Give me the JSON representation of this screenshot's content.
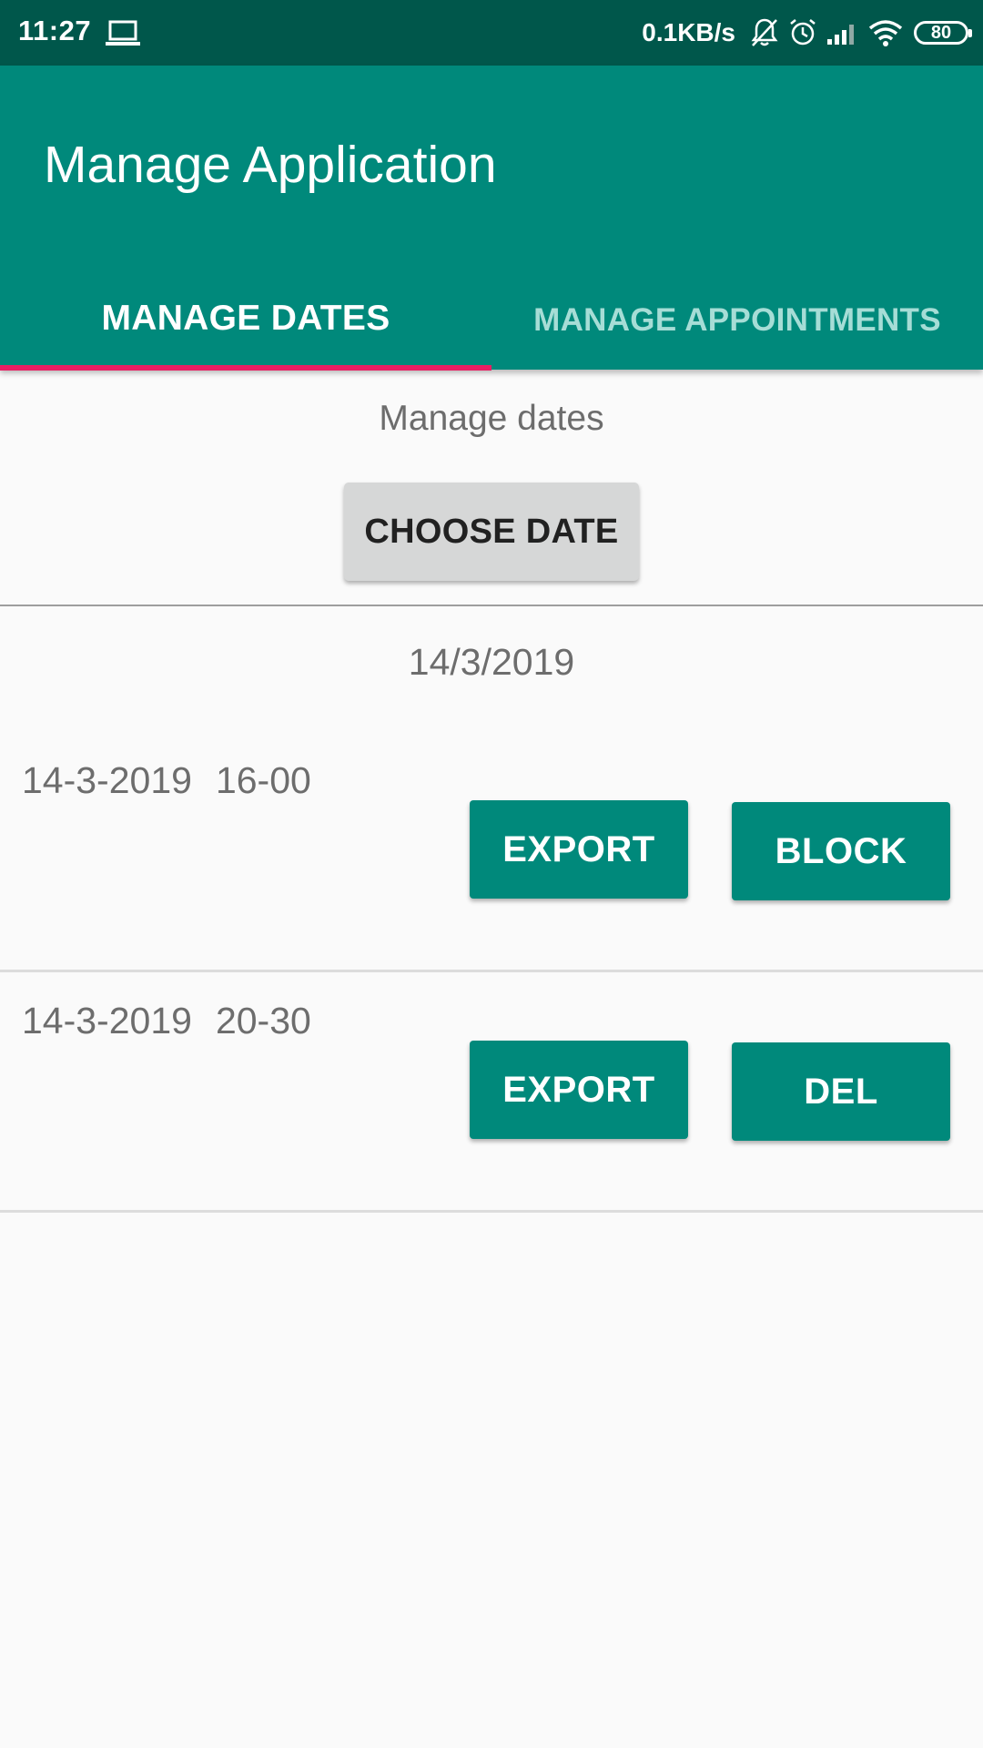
{
  "status_bar": {
    "time": "11:27",
    "net_speed": "0.1KB/s",
    "battery": "80",
    "icons": [
      "laptop-icon",
      "bell-off-icon",
      "alarm-icon",
      "signal-icon",
      "wifi-icon",
      "battery-icon"
    ]
  },
  "app_bar": {
    "title": "Manage Application",
    "tabs": [
      {
        "label": "MANAGE DATES",
        "selected": true
      },
      {
        "label": "MANAGE APPOINTMENTS",
        "selected": false
      }
    ],
    "colors": {
      "primary": "#00897b",
      "primary_dark": "#00574b",
      "accent": "#e91e63"
    }
  },
  "main": {
    "section_title": "Manage dates",
    "choose_date_label": "CHOOSE DATE",
    "selected_date": "14/3/2019",
    "rows": [
      {
        "date": "14-3-2019",
        "time": "16-00",
        "export_label": "EXPORT",
        "action_label": "BLOCK"
      },
      {
        "date": "14-3-2019",
        "time": "20-30",
        "export_label": "EXPORT",
        "action_label": "DEL"
      }
    ]
  }
}
